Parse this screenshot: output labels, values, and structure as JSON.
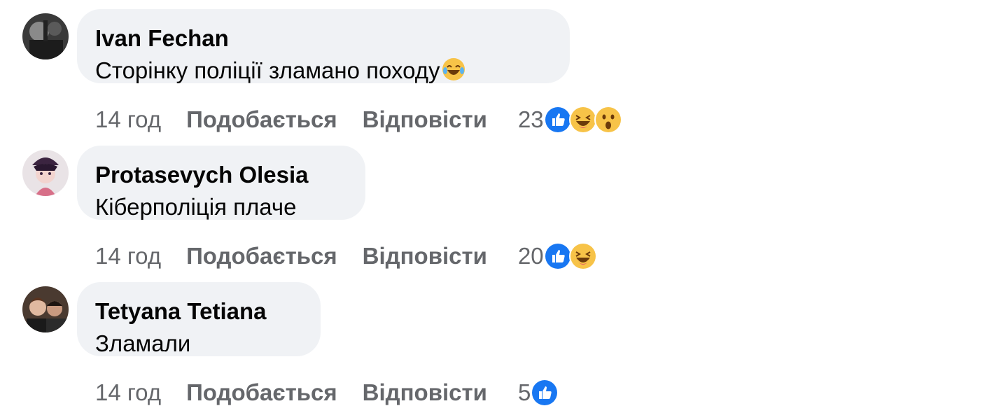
{
  "comments": [
    {
      "author": "Ivan Fechan",
      "text": "Сторінку поліції зламано походу",
      "text_emoji": "laughing-tears-emoji",
      "time": "14 год",
      "like_label": "Подобається",
      "reply_label": "Відповісти",
      "reaction_count": "23",
      "reactions": [
        "like-icon",
        "haha-icon",
        "wow-icon"
      ]
    },
    {
      "author": "Protasevych Olesia",
      "text": "Кіберполіція плаче",
      "time": "14 год",
      "like_label": "Подобається",
      "reply_label": "Відповісти",
      "reaction_count": "20",
      "reactions": [
        "like-icon",
        "haha-icon"
      ]
    },
    {
      "author": "Tetyana Tetiana",
      "text": "Зламали",
      "time": "14 год",
      "like_label": "Подобається",
      "reply_label": "Відповісти",
      "reaction_count": "5",
      "reactions": [
        "like-icon"
      ]
    }
  ],
  "colors": {
    "bubble": "#f0f2f5",
    "meta_text": "#65676b",
    "like_blue": "#1877f2",
    "emoji_yellow": "#f7c348"
  }
}
